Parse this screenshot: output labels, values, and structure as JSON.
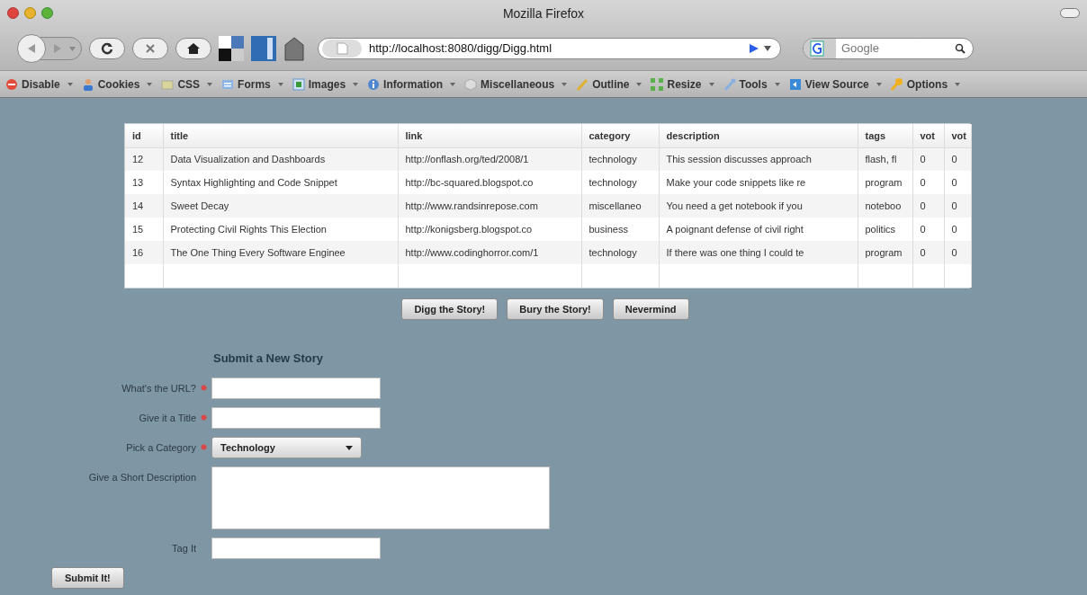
{
  "window": {
    "title": "Mozilla Firefox"
  },
  "address_bar": {
    "value": "http://localhost:8080/digg/Digg.html"
  },
  "search_field": {
    "placeholder": "Google"
  },
  "toolbar": [
    {
      "label": "Disable"
    },
    {
      "label": "Cookies"
    },
    {
      "label": "CSS"
    },
    {
      "label": "Forms"
    },
    {
      "label": "Images"
    },
    {
      "label": "Information"
    },
    {
      "label": "Miscellaneous"
    },
    {
      "label": "Outline"
    },
    {
      "label": "Resize"
    },
    {
      "label": "Tools"
    },
    {
      "label": "View Source"
    },
    {
      "label": "Options"
    }
  ],
  "table": {
    "columns": [
      "id",
      "title",
      "link",
      "category",
      "description",
      "tags",
      "vot",
      "vot"
    ],
    "rows": [
      [
        "12",
        "Data Visualization and Dashboards",
        "http://onflash.org/ted/2008/1",
        "technology",
        "This session discusses approach",
        "flash, fl",
        "0",
        "0"
      ],
      [
        "13",
        "Syntax Highlighting and Code Snippet",
        "http://bc-squared.blogspot.co",
        "technology",
        "Make your code snippets like re",
        "program",
        "0",
        "0"
      ],
      [
        "14",
        "Sweet Decay",
        "http://www.randsinrepose.com",
        "miscellaneo",
        "You need a get notebook if you",
        "noteboo",
        "0",
        "0"
      ],
      [
        "15",
        "Protecting Civil Rights This Election",
        "http://konigsberg.blogspot.co",
        "business",
        "A poignant defense of civil right",
        "politics",
        "0",
        "0"
      ],
      [
        "16",
        "The One Thing Every Software Enginee",
        "http://www.codinghorror.com/1",
        "technology",
        "If there was one thing I could te",
        "program",
        "0",
        "0"
      ]
    ]
  },
  "actions": [
    "Digg the Story!",
    "Bury the Story!",
    "Nevermind"
  ],
  "form": {
    "heading": "Submit a New Story",
    "fields": [
      {
        "label": "What's the URL?",
        "kind": "input",
        "required": true
      },
      {
        "label": "Give it a Title",
        "kind": "input",
        "required": true
      },
      {
        "label": "Pick a Category",
        "kind": "select",
        "required": true,
        "value": "Technology"
      },
      {
        "label": "Give a Short Description",
        "kind": "textarea",
        "required": false
      },
      {
        "label": "Tag It",
        "kind": "input",
        "required": false
      }
    ],
    "submit": "Submit It!"
  }
}
